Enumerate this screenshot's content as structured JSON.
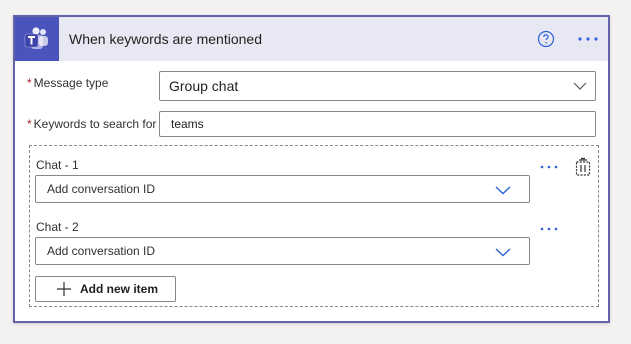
{
  "header": {
    "title": "When keywords are mentioned",
    "logo_icon": "teams-logo-icon",
    "help_icon": "help-circle-icon",
    "more_icon": "more-horizontal-icon"
  },
  "fields": {
    "message_type": {
      "required_mark": "*",
      "label": "Message type",
      "value": "Group chat"
    },
    "keywords": {
      "required_mark": "*",
      "label": "Keywords to search for",
      "value": "teams"
    }
  },
  "array": {
    "items": [
      {
        "label": "Chat - 1",
        "placeholder": "Add conversation ID"
      },
      {
        "label": "Chat - 2",
        "placeholder": "Add conversation ID"
      }
    ],
    "add_button_label": "Add new item"
  },
  "colors": {
    "brand": "#4b53bc",
    "accent_border": "#6264a7",
    "header_bg": "#e8e8f4",
    "required": "#a4262c",
    "link_blue": "#2b63d6"
  }
}
